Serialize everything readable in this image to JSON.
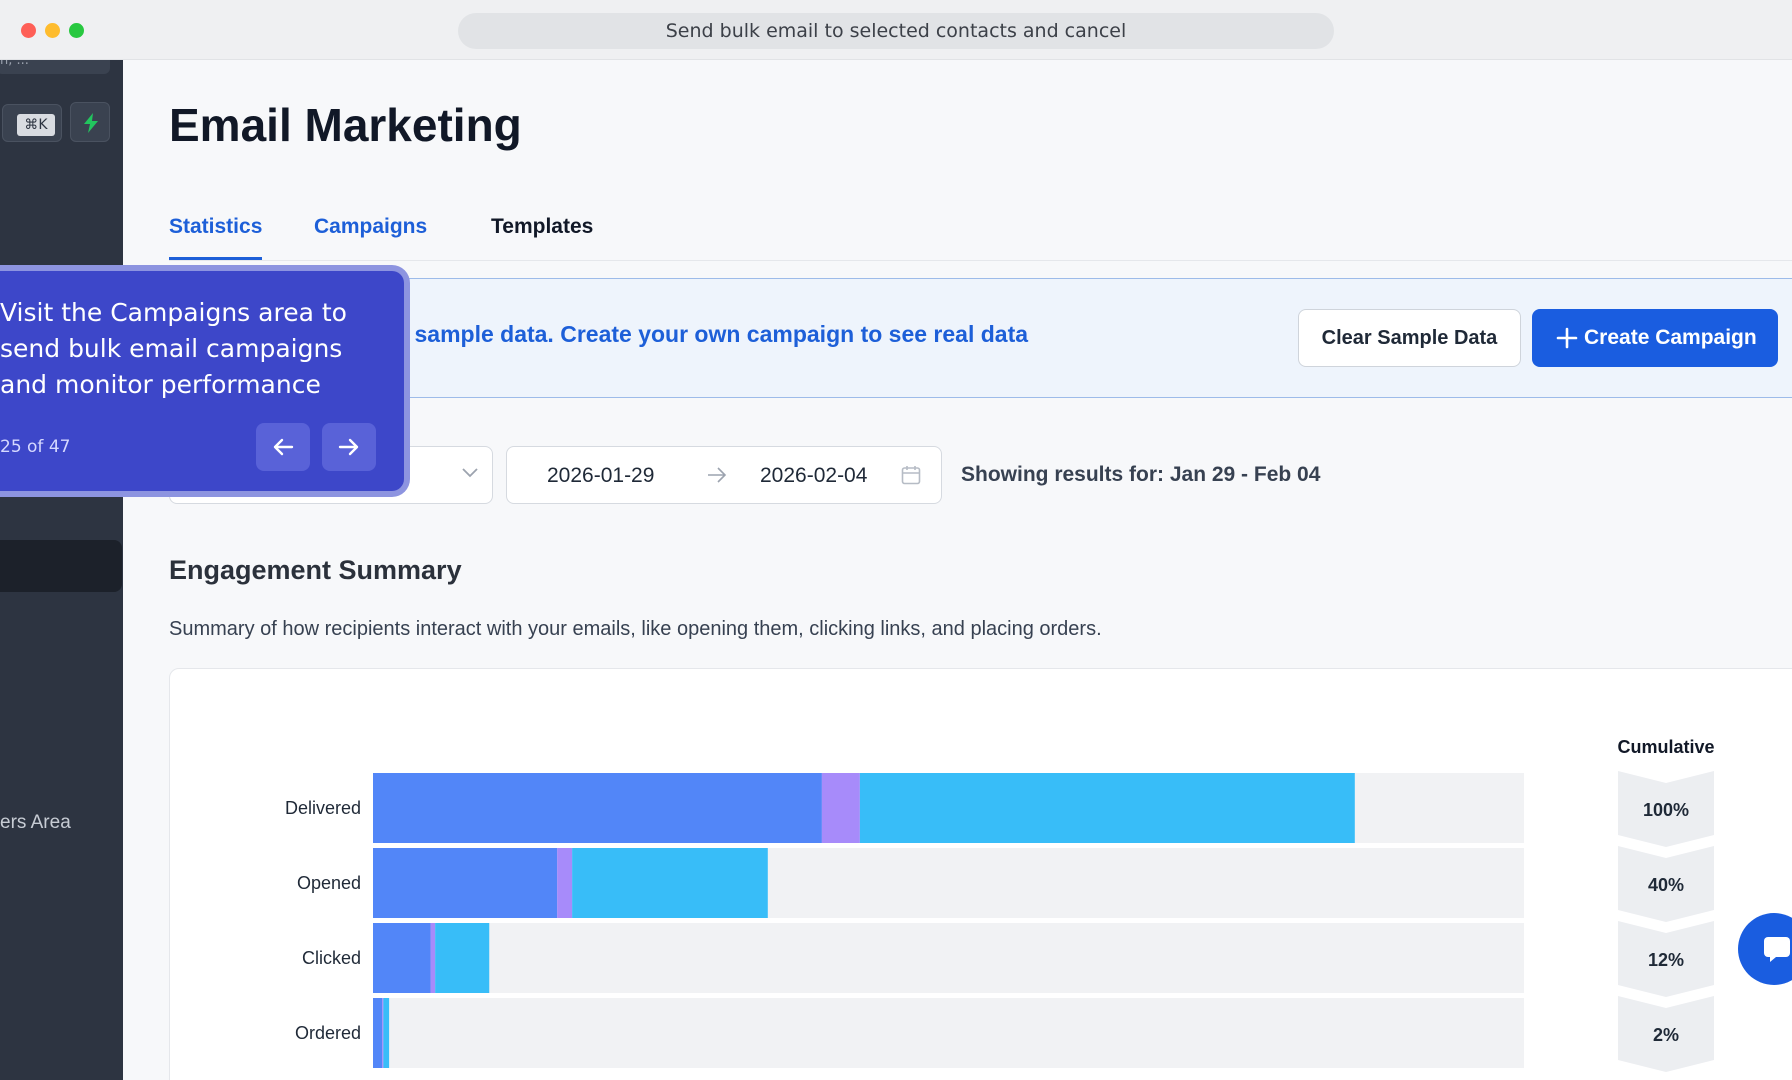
{
  "window": {
    "address_bar": "Send bulk email to selected contacts and cancel"
  },
  "sidebar": {
    "search_stub": "n, ...",
    "shortcut": "⌘K",
    "area_label": "ers Area",
    "icons": [
      "bolt-icon",
      "chevron-left-icon"
    ]
  },
  "page": {
    "title": "Email Marketing",
    "tabs": [
      {
        "label": "Statistics",
        "active": true
      },
      {
        "label": "Campaigns",
        "active": false
      },
      {
        "label": "Templates",
        "active": false
      }
    ]
  },
  "banner": {
    "text": "ng sample data. Create your own campaign to see real data",
    "clear_button": "Clear Sample Data",
    "create_button": "Create Campaign"
  },
  "filters": {
    "range_select_value": "",
    "date_start": "2026-01-29",
    "date_end": "2026-02-04",
    "showing": "Showing results for: Jan 29 - Feb 04"
  },
  "engagement": {
    "title": "Engagement Summary",
    "subtitle": "Summary of how recipients interact with your emails, like opening them, clicking links, and placing orders."
  },
  "chart_data": {
    "type": "bar",
    "orientation": "horizontal",
    "stacked": true,
    "categories": [
      "Delivered",
      "Opened",
      "Clicked",
      "Ordered"
    ],
    "series": [
      {
        "color": "#5286f8",
        "values": [
          39,
          16,
          5,
          0.8
        ]
      },
      {
        "color": "#a78bfa",
        "values": [
          3.3,
          1.3,
          0.4,
          0.1
        ]
      },
      {
        "color": "#38bdf8",
        "values": [
          43,
          17,
          4.7,
          0.5
        ]
      }
    ],
    "xlim": [
      0,
      100
    ],
    "cumulative_label": "Cumulative",
    "cumulative": [
      "100%",
      "40%",
      "12%",
      "2%"
    ],
    "colors": {
      "track": "#f1f2f4",
      "chevron": "#eceef1"
    }
  },
  "tour": {
    "text": "Visit the Campaigns area to send bulk email campaigns and monitor performance",
    "counter": "25 of 47"
  },
  "colors": {
    "accent": "#1a5de0",
    "sidebar": "#2d3441",
    "tour": "#3d47c9"
  }
}
